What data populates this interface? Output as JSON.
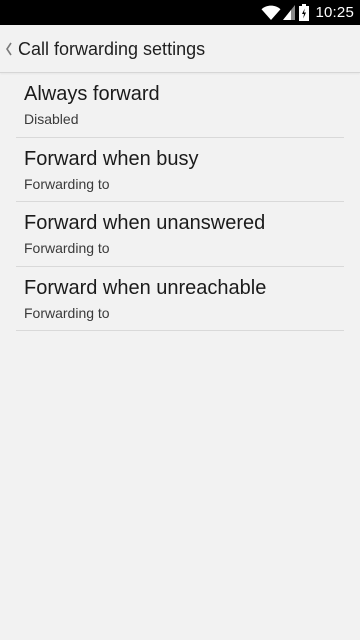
{
  "status_bar": {
    "time": "10:25",
    "icons": [
      "wifi-icon",
      "signal-icon",
      "battery-icon"
    ]
  },
  "action_bar": {
    "title": "Call forwarding settings",
    "back_icon": "chevron-left-icon"
  },
  "settings": [
    {
      "title": "Always forward",
      "summary": "Disabled"
    },
    {
      "title": "Forward when busy",
      "summary": "Forwarding to"
    },
    {
      "title": "Forward when unanswered",
      "summary": "Forwarding to"
    },
    {
      "title": "Forward when unreachable",
      "summary": "Forwarding to"
    }
  ]
}
